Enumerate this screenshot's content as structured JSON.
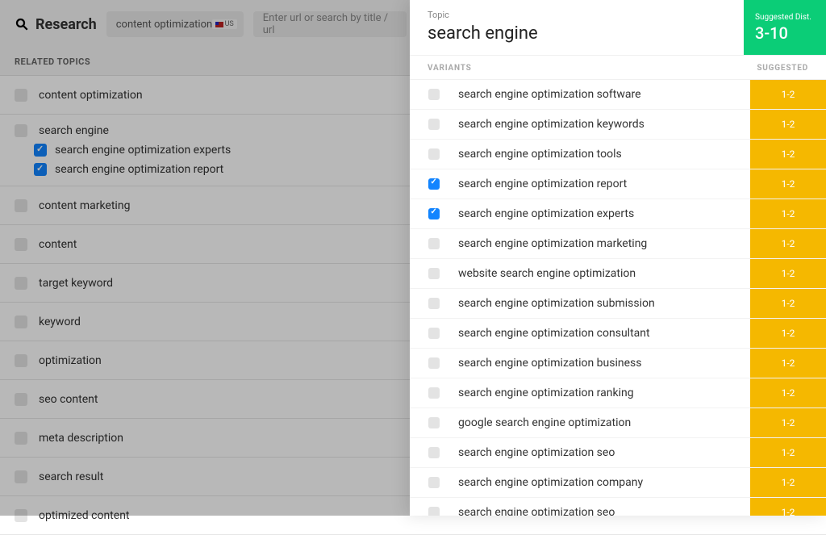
{
  "header": {
    "title": "Research",
    "topic_input": "content optimization",
    "region": "US",
    "url_placeholder": "Enter url or search by title / url"
  },
  "section_header": "RELATED TOPICS",
  "topics": [
    {
      "label": "content optimization",
      "checked": false
    },
    {
      "label": "search engine",
      "checked": false,
      "expanded": true,
      "sub": [
        {
          "label": "search engine optimization experts",
          "checked": true
        },
        {
          "label": "search engine optimization report",
          "checked": true
        }
      ]
    },
    {
      "label": "content marketing",
      "checked": false
    },
    {
      "label": "content",
      "checked": false
    },
    {
      "label": "target keyword",
      "checked": false
    },
    {
      "label": "keyword",
      "checked": false
    },
    {
      "label": "optimization",
      "checked": false
    },
    {
      "label": "seo content",
      "checked": false
    },
    {
      "label": "meta description",
      "checked": false
    },
    {
      "label": "search result",
      "checked": false
    },
    {
      "label": "optimized content",
      "checked": false
    }
  ],
  "panel": {
    "topic_label": "Topic",
    "topic_name": "search engine",
    "suggested_label": "Suggested Dist.",
    "suggested_range": "3-10",
    "col_variants": "VARIANTS",
    "col_suggested": "SUGGESTED",
    "variants": [
      {
        "label": "search engine optimization software",
        "checked": false,
        "suggested": "1-2"
      },
      {
        "label": "search engine optimization keywords",
        "checked": false,
        "suggested": "1-2"
      },
      {
        "label": "search engine optimization tools",
        "checked": false,
        "suggested": "1-2"
      },
      {
        "label": "search engine optimization report",
        "checked": true,
        "suggested": "1-2"
      },
      {
        "label": "search engine optimization experts",
        "checked": true,
        "suggested": "1-2"
      },
      {
        "label": "search engine optimization marketing",
        "checked": false,
        "suggested": "1-2"
      },
      {
        "label": "website search engine optimization",
        "checked": false,
        "suggested": "1-2"
      },
      {
        "label": "search engine optimization submission",
        "checked": false,
        "suggested": "1-2"
      },
      {
        "label": "search engine optimization consultant",
        "checked": false,
        "suggested": "1-2"
      },
      {
        "label": "search engine optimization business",
        "checked": false,
        "suggested": "1-2"
      },
      {
        "label": "search engine optimization ranking",
        "checked": false,
        "suggested": "1-2"
      },
      {
        "label": "google search engine optimization",
        "checked": false,
        "suggested": "1-2"
      },
      {
        "label": "search engine optimization seo",
        "checked": false,
        "suggested": "1-2"
      },
      {
        "label": "search engine optimization company",
        "checked": false,
        "suggested": "1-2"
      },
      {
        "label": "search engine optimization seo",
        "checked": false,
        "suggested": "1-2"
      }
    ]
  }
}
